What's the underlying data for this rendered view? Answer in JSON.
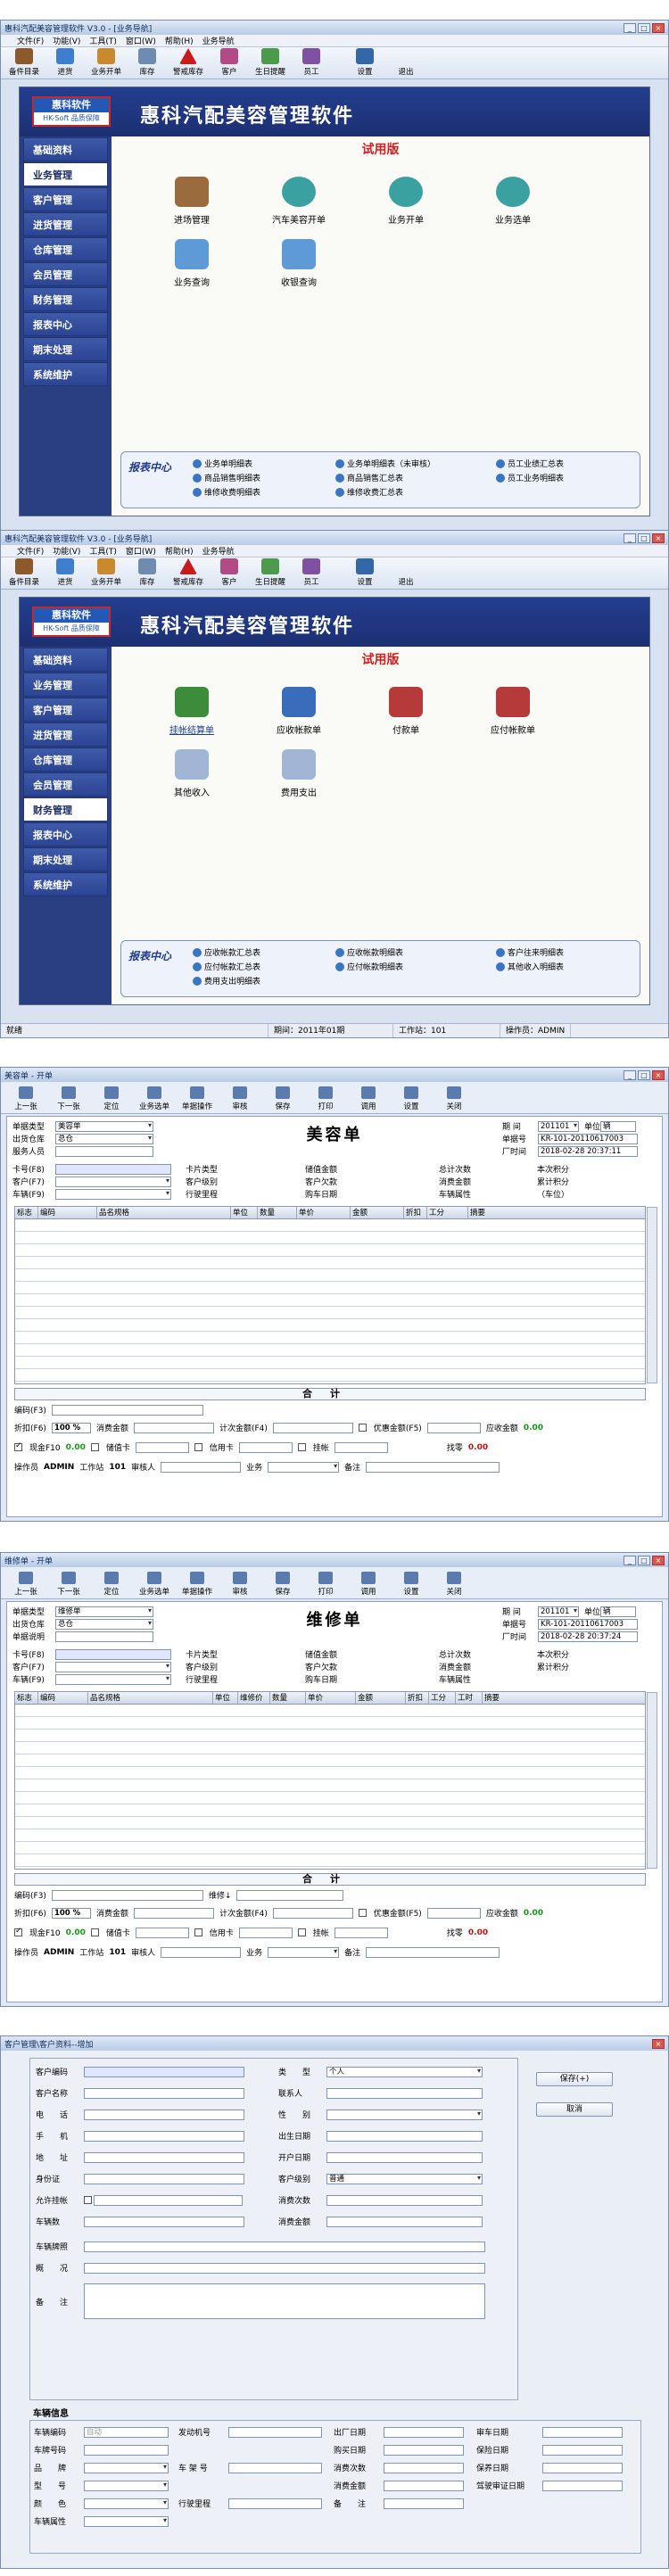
{
  "shot1": {
    "title": "惠科汽配美容管理软件 V3.0 - [业务导航]",
    "menu": [
      "文件(F)",
      "功能(V)",
      "工具(T)",
      "窗口(W)",
      "帮助(H)",
      "业务导航"
    ],
    "toolbar": [
      "备件目录",
      "进货",
      "业务开单",
      "库存",
      "警戒库存",
      "客户",
      "生日提醒",
      "员工",
      "设置",
      "退出"
    ],
    "logo": {
      "name": "惠科软件",
      "sub": "HK-Soft 品质保障"
    },
    "app_title": "惠科汽配美容管理软件",
    "edition": "试用版",
    "nav": [
      "基础资料",
      "业务管理",
      "客户管理",
      "进货管理",
      "仓库管理",
      "会员管理",
      "财务管理",
      "报表中心",
      "期末处理",
      "系统维护"
    ],
    "selected_nav": "业务管理",
    "modules": [
      "进场管理",
      "汽车美容开单",
      "业务开单",
      "业务选单",
      "业务查询",
      "收银查询"
    ],
    "report_title": "报表中心",
    "reports": [
      "业务单明细表",
      "业务单明细表（未审核）",
      "员工业绩汇总表",
      "商品销售明细表",
      "商品销售汇总表",
      "员工业务明细表",
      "维修收费明细表",
      "维修收费汇总表"
    ],
    "status": {
      "ready": "就绪",
      "period": "期间：2011年01期",
      "station": "工作站：101",
      "operator": "操作员：ADMIN"
    }
  },
  "shot2": {
    "title": "惠科汽配美容管理软件 V3.0 - [业务导航]",
    "selected_nav": "财务管理",
    "modules": [
      "挂帐结算单",
      "应收帐款单",
      "付款单",
      "应付帐款单",
      "其他收入",
      "费用支出"
    ],
    "report_title": "报表中心",
    "reports": [
      "应收帐款汇总表",
      "应收帐款明细表",
      "客户往来明细表",
      "应付帐款汇总表",
      "应付帐款明细表",
      "其他收入明细表",
      "费用支出明细表"
    ]
  },
  "shot3": {
    "title": "美容单 - 开单",
    "toolbar": [
      "上一张",
      "下一张",
      "定位",
      "业务选单",
      "单据操作",
      "审核",
      "保存",
      "打印",
      "调用",
      "设置",
      "关闭"
    ],
    "form_title": "美容单",
    "fields": {
      "doc_type_label": "单据类型",
      "doc_type": "美容单",
      "out_wh_label": "出货仓库",
      "out_wh": "总仓",
      "service_label": "服务人员",
      "period_label": "期 间",
      "period": "201101",
      "unit_label": "单位",
      "unit": "辆",
      "docno_label": "单据号",
      "docno": "KR-101-20110617003",
      "date_label": "厂时间",
      "date": "2018-02-28 20:37:11"
    },
    "card_rows": [
      [
        "卡号(F8)",
        "卡片类型",
        "储值金额",
        "总计次数",
        "本次积分"
      ],
      [
        "客户(F7)",
        "客户级别",
        "客户欠款",
        "消费金额",
        "累计积分"
      ],
      [
        "车辆(F9)",
        "行驶里程",
        "购车日期",
        "车辆属性",
        "（车位）"
      ]
    ],
    "grid_cols": [
      "标志",
      "编码",
      "品名规格",
      "单位",
      "数量",
      "单价",
      "金额",
      "折扣",
      "工分",
      "摘要"
    ],
    "sum_label": "合计",
    "code_label": "编码(F3)",
    "footer": {
      "discount_label": "折扣(F6)",
      "discount": "100 %",
      "consume_label": "消费金额",
      "calc_label": "计次金额(F4)",
      "prefer_label": "优惠金额(F5)",
      "receivable_label": "应收金额",
      "receivable": "0.00",
      "cash_label": "现金F10",
      "cash": "0.00",
      "stored_label": "储值卡",
      "credit_label": "信用卡",
      "hang_label": "挂帐",
      "change_label": "找零",
      "change": "0.00",
      "operator_label": "操作员",
      "operator": "ADMIN",
      "station_label": "工作站",
      "station": "101",
      "auditor_label": "审核人",
      "business_label": "业务",
      "remark_label": "备注"
    }
  },
  "shot4": {
    "title": "维修单 - 开单",
    "form_title": "维修单",
    "doc_type": "维修单",
    "docno": "KR-101-20110617003",
    "date": "2018-02-28 20:37:24",
    "repair_label": "单据说明",
    "grid_cols": [
      "标志",
      "编码",
      "品名规格",
      "单位",
      "维修价",
      "数量",
      "单价",
      "金额",
      "折扣",
      "工分",
      "工时",
      "摘要"
    ],
    "repair_label2": "维修↓"
  },
  "shot5": {
    "title": "客户管理\\客户资料--增加",
    "left_labels": [
      "客户编码",
      "客户名称",
      "电　　话",
      "手　　机",
      "地　　址",
      "身份证",
      "允许挂帐",
      "车辆数"
    ],
    "right_labels": [
      "类　　型",
      "联系人",
      "性　　别",
      "出生日期",
      "开户日期",
      "客户级别",
      "消费次数",
      "消费金额"
    ],
    "type_value": "个人",
    "level_value": "普通",
    "extra_labels": [
      "车辆牌照",
      "概　　况",
      "备　　注"
    ],
    "buttons": [
      "保存(+)",
      "取消"
    ],
    "vehicle_title": "车辆信息",
    "vehicle_col1": [
      "车辆编码",
      "车牌号码",
      "品　　牌",
      "型　　号",
      "颜　　色",
      "车辆属性"
    ],
    "vehicle_col1_value": "自动",
    "vehicle_col2": [
      "发动机号",
      "车 架 号",
      "行驶里程"
    ],
    "vehicle_col3": [
      "出厂日期",
      "购买日期",
      "消费次数",
      "消费金额",
      "备　　注"
    ],
    "vehicle_col4": [
      "审车日期",
      "保险日期",
      "保养日期",
      "驾驶审证日期"
    ]
  }
}
